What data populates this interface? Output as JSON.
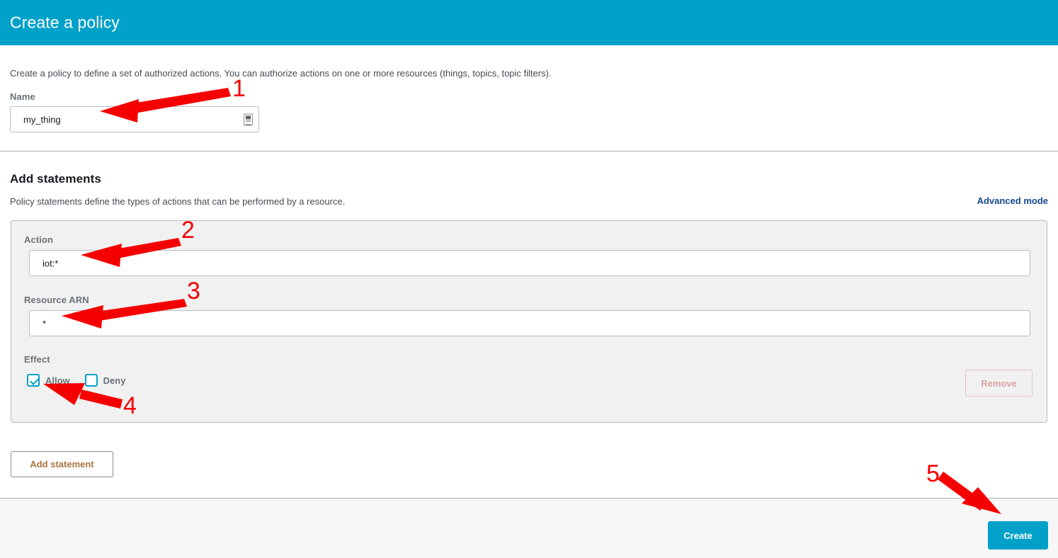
{
  "header": {
    "title": "Create a policy",
    "background_color": "#00a1c9"
  },
  "intro": {
    "text": "Create a policy to define a set of authorized actions. You can authorize actions on one or more resources (things, topics, topic filters)."
  },
  "name_field": {
    "label": "Name",
    "value": "my_thing",
    "placeholder": "",
    "icon": "form-fill-icon"
  },
  "statements_section": {
    "title": "Add statements",
    "description": "Policy statements define the types of actions that can be performed by a resource.",
    "advanced_mode_label": "Advanced mode",
    "advanced_mode_color": "#16458f"
  },
  "statement": {
    "action": {
      "label": "Action",
      "value": "iot:*",
      "placeholder": ""
    },
    "resource": {
      "label": "Resource ARN",
      "value": "*",
      "placeholder": ""
    },
    "effect": {
      "label": "Effect",
      "options": [
        {
          "label": "Allow",
          "checked": true
        },
        {
          "label": "Deny",
          "checked": false
        }
      ],
      "checkbox_color": "#00a1c9"
    },
    "remove_label": "Remove",
    "remove_disabled": true,
    "panel_background": "#f1f1f1"
  },
  "add_statement_button": {
    "label": "Add statement",
    "text_color": "#a9743f"
  },
  "footer": {
    "create_label": "Create",
    "create_color": "#00a1c9"
  },
  "annotations": [
    {
      "number": "1",
      "target": "name-input"
    },
    {
      "number": "2",
      "target": "action-input"
    },
    {
      "number": "3",
      "target": "resource-arn-input"
    },
    {
      "number": "4",
      "target": "allow-checkbox"
    },
    {
      "number": "5",
      "target": "create-button"
    }
  ]
}
